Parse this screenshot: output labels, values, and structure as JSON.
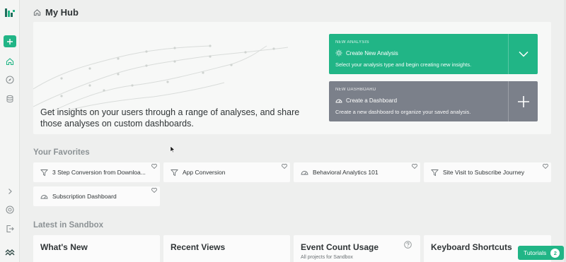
{
  "app": {
    "title": "My Hub"
  },
  "colors": {
    "accent": "#21b586",
    "secondary_action": "#7b808a"
  },
  "nav": {
    "icons": [
      "logo-icon",
      "add-icon",
      "home-icon",
      "compass-icon",
      "database-icon",
      "expand-icon",
      "help-icon",
      "logout-icon",
      "brand-icon"
    ]
  },
  "hero": {
    "tagline": "Get insights on your users through a range of analyses, and share those analyses on custom dashboards.",
    "new_analysis": {
      "kicker": "NEW ANALYSIS",
      "title": "Create New Analysis",
      "description": "Select your analysis type and begin creating new insights."
    },
    "new_dashboard": {
      "kicker": "NEW DASHBOARD",
      "title": "Create a Dashboard",
      "description": "Create a new dashboard to organize your saved analysis."
    }
  },
  "favorites": {
    "heading": "Your Favorites",
    "items": [
      {
        "label": "3 Step Conversion from Downloa...",
        "icon": "funnel-icon"
      },
      {
        "label": "App Conversion",
        "icon": "funnel-icon"
      },
      {
        "label": "Behavioral Analytics 101",
        "icon": "dashboard-icon"
      },
      {
        "label": "Site Visit to Subscribe Journey",
        "icon": "funnel-icon"
      },
      {
        "label": "Subscription Dashboard",
        "icon": "dashboard-icon"
      }
    ]
  },
  "latest": {
    "heading": "Latest in Sandbox",
    "cards": [
      {
        "title": "What's New",
        "subtitle": ""
      },
      {
        "title": "Recent Views",
        "subtitle": ""
      },
      {
        "title": "Event Count Usage",
        "subtitle": "All projects for Sandbox"
      },
      {
        "title": "Keyboard Shortcuts",
        "subtitle": ""
      }
    ]
  },
  "tutorials": {
    "label": "Tutorials",
    "count": "2"
  }
}
